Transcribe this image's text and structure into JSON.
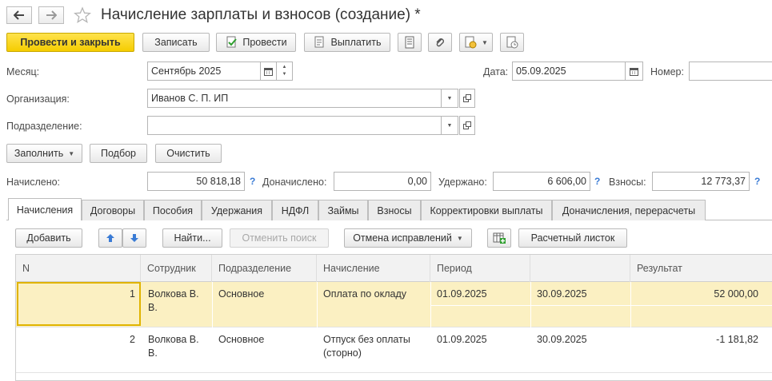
{
  "window": {
    "title": "Начисление зарплаты и взносов (создание) *"
  },
  "toolbar": {
    "post_and_close": "Провести и закрыть",
    "save": "Записать",
    "post": "Провести",
    "pay": "Выплатить"
  },
  "header": {
    "month_label": "Месяц:",
    "month_value": "Сентябрь 2025",
    "date_label": "Дата:",
    "date_value": "05.09.2025",
    "number_label": "Номер:",
    "number_value": "",
    "org_label": "Организация:",
    "org_value": "Иванов С. П. ИП",
    "dept_label": "Подразделение:",
    "dept_value": ""
  },
  "actions": {
    "fill": "Заполнить",
    "pick": "Подбор",
    "clear": "Очистить"
  },
  "totals": {
    "accrued_label": "Начислено:",
    "accrued_value": "50 818,18",
    "extra_label": "Доначислено:",
    "extra_value": "0,00",
    "withheld_label": "Удержано:",
    "withheld_value": "6 606,00",
    "contrib_label": "Взносы:",
    "contrib_value": "12 773,37",
    "help": "?"
  },
  "tabs": [
    "Начисления",
    "Договоры",
    "Пособия",
    "Удержания",
    "НДФЛ",
    "Займы",
    "Взносы",
    "Корректировки выплаты",
    "Доначисления, перерасчеты"
  ],
  "table_toolbar": {
    "add": "Добавить",
    "find": "Найти...",
    "cancel_search": "Отменить поиск",
    "cancel_corrections": "Отмена исправлений",
    "payslip": "Расчетный листок"
  },
  "table": {
    "columns": [
      "N",
      "Сотрудник",
      "Подразделение",
      "Начисление",
      "Период",
      "",
      "Результат"
    ],
    "rows": [
      {
        "n": "1",
        "employee": "Волкова В. В.",
        "department": "Основное",
        "accrual": "Оплата по окладу",
        "period_start": "01.09.2025",
        "period_end": "30.09.2025",
        "result": "52 000,00"
      },
      {
        "n": "2",
        "employee": "Волкова В. В.",
        "department": "Основное",
        "accrual": "Отпуск без оплаты (сторно)",
        "period_start": "01.09.2025",
        "period_end": "30.09.2025",
        "result": "-1 181,82"
      }
    ]
  },
  "colors": {
    "primary_button": "#f5cd00",
    "selected_row": "#fbf0c2",
    "selected_cell_border": "#e0b400",
    "help_blue": "#3a7bd5"
  }
}
